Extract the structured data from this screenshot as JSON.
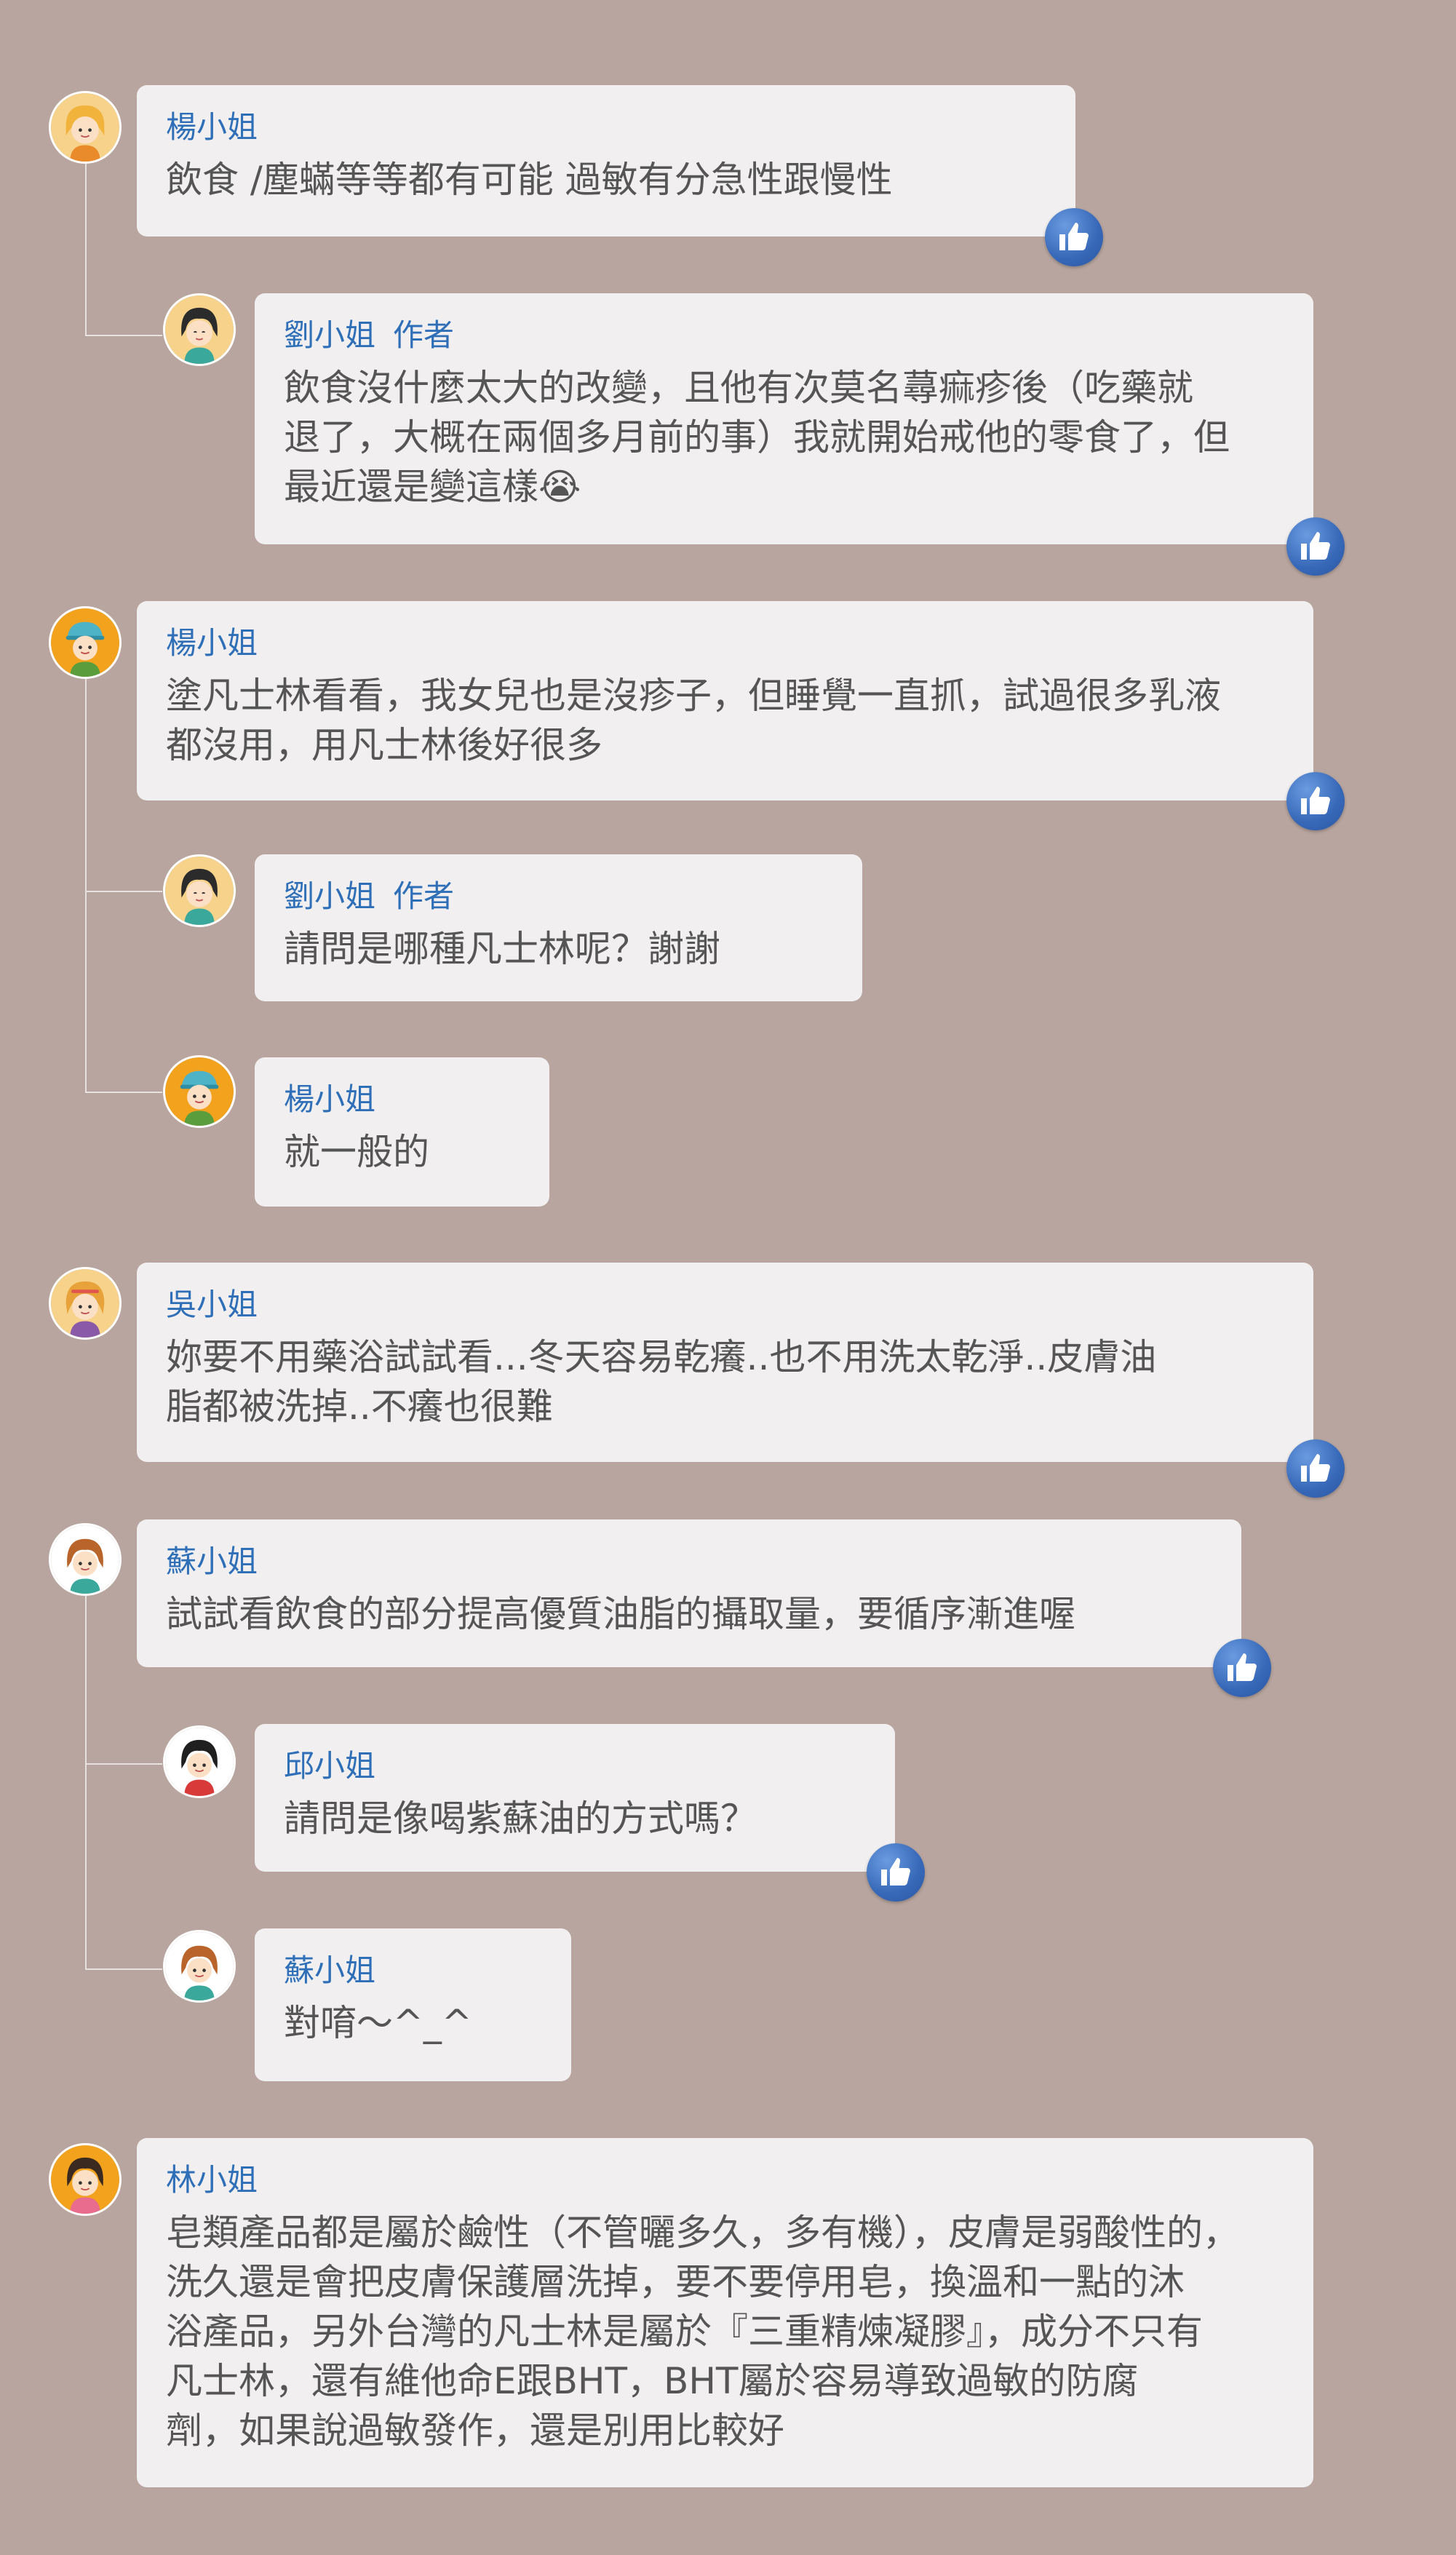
{
  "comments": [
    {
      "name": "楊小姐",
      "text": "飲食 /塵蟎等等都有可能 過敏有分急性跟慢性",
      "liked": true
    },
    {
      "name": "劉小姐",
      "badge": "作者",
      "text": "飲食沒什麼太大的改變，且他有次莫名蕁痲疹後（吃藥就\n退了，大概在兩個多月前的事）我就開始戒他的零食了，但\n最近還是變這樣😭",
      "liked": true
    },
    {
      "name": "楊小姐",
      "text": "塗凡士林看看，我女兒也是沒疹子，但睡覺一直抓，試過很多乳液\n都沒用，用凡士林後好很多",
      "liked": true
    },
    {
      "name": "劉小姐",
      "badge": "作者",
      "text": "請問是哪種凡士林呢？謝謝",
      "liked": false
    },
    {
      "name": "楊小姐",
      "text": "就一般的",
      "liked": false
    },
    {
      "name": "吳小姐",
      "text": "妳要不用藥浴試試看...冬天容易乾癢..也不用洗太乾淨..皮膚油\n脂都被洗掉..不癢也很難",
      "liked": true
    },
    {
      "name": "蘇小姐",
      "text": "試試看飲食的部分提高優質油脂的攝取量，要循序漸進喔",
      "liked": true
    },
    {
      "name": "邱小姐",
      "text": "請問是像喝紫蘇油的方式嗎？",
      "liked": true
    },
    {
      "name": "蘇小姐",
      "text": "對唷～^_^",
      "liked": false
    },
    {
      "name": "林小姐",
      "text": "皂類產品都是屬於鹼性（不管曬多久，多有機），皮膚是弱酸性的，\n洗久還是會把皮膚保護層洗掉，要不要停用皂，換溫和一點的沐\n浴產品，另外台灣的凡士林是屬於『三重精煉凝膠』，成分不只有\n凡士林，還有維他命E跟BHT，BHT屬於容易導致過敏的防腐\n劑，如果說過敏發作，還是別用比較好",
      "liked": false
    }
  ],
  "colors": {
    "background": "#b8a59f",
    "bubble": "#f1efef",
    "name": "#2e6fb8",
    "text": "#555555",
    "like": "#3768b8"
  },
  "icons": {
    "like": "thumbs-up-icon",
    "avatar": "avatar-icon"
  }
}
